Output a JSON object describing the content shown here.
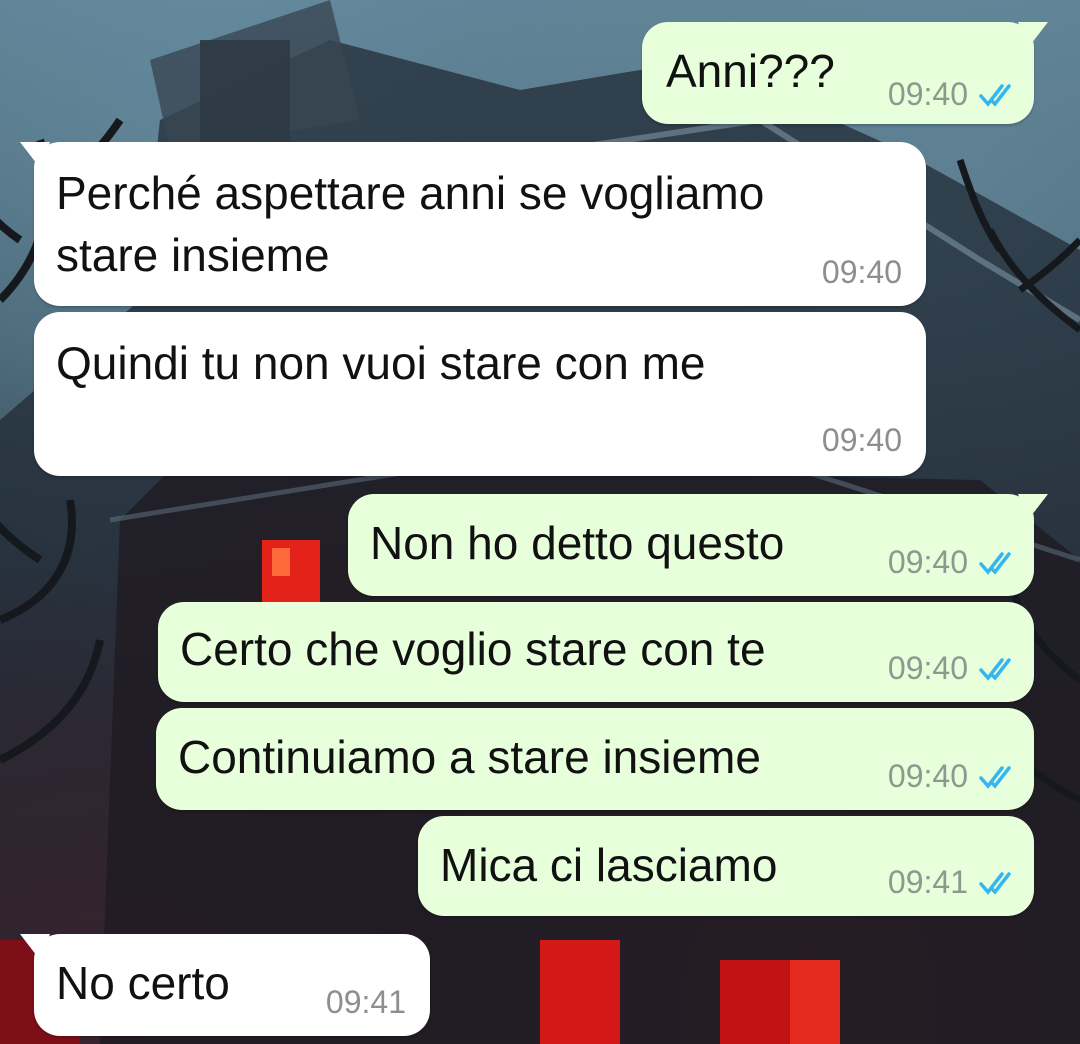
{
  "messages": [
    {
      "text": "Anni???",
      "time": "09:40",
      "direction": "outgoing",
      "status_icon": "double-check-read-icon"
    },
    {
      "text": "Perché aspettare anni se vogliamo\nstare insieme",
      "time": "09:40",
      "direction": "incoming"
    },
    {
      "text": "Quindi tu non vuoi stare con me",
      "time": "09:40",
      "direction": "incoming"
    },
    {
      "text": "Non ho detto questo",
      "time": "09:40",
      "direction": "outgoing",
      "status_icon": "double-check-read-icon"
    },
    {
      "text": "Certo che voglio stare con te",
      "time": "09:40",
      "direction": "outgoing",
      "status_icon": "double-check-read-icon"
    },
    {
      "text": "Continuiamo a stare insieme",
      "time": "09:40",
      "direction": "outgoing",
      "status_icon": "double-check-read-icon"
    },
    {
      "text": "Mica ci lasciamo",
      "time": "09:41",
      "direction": "outgoing",
      "status_icon": "double-check-read-icon"
    },
    {
      "text": "No certo",
      "time": "09:41",
      "direction": "incoming"
    }
  ],
  "colors": {
    "outgoing_bubble": "#e7ffdb",
    "incoming_bubble": "#ffffff",
    "read_ticks": "#34b7f1"
  }
}
